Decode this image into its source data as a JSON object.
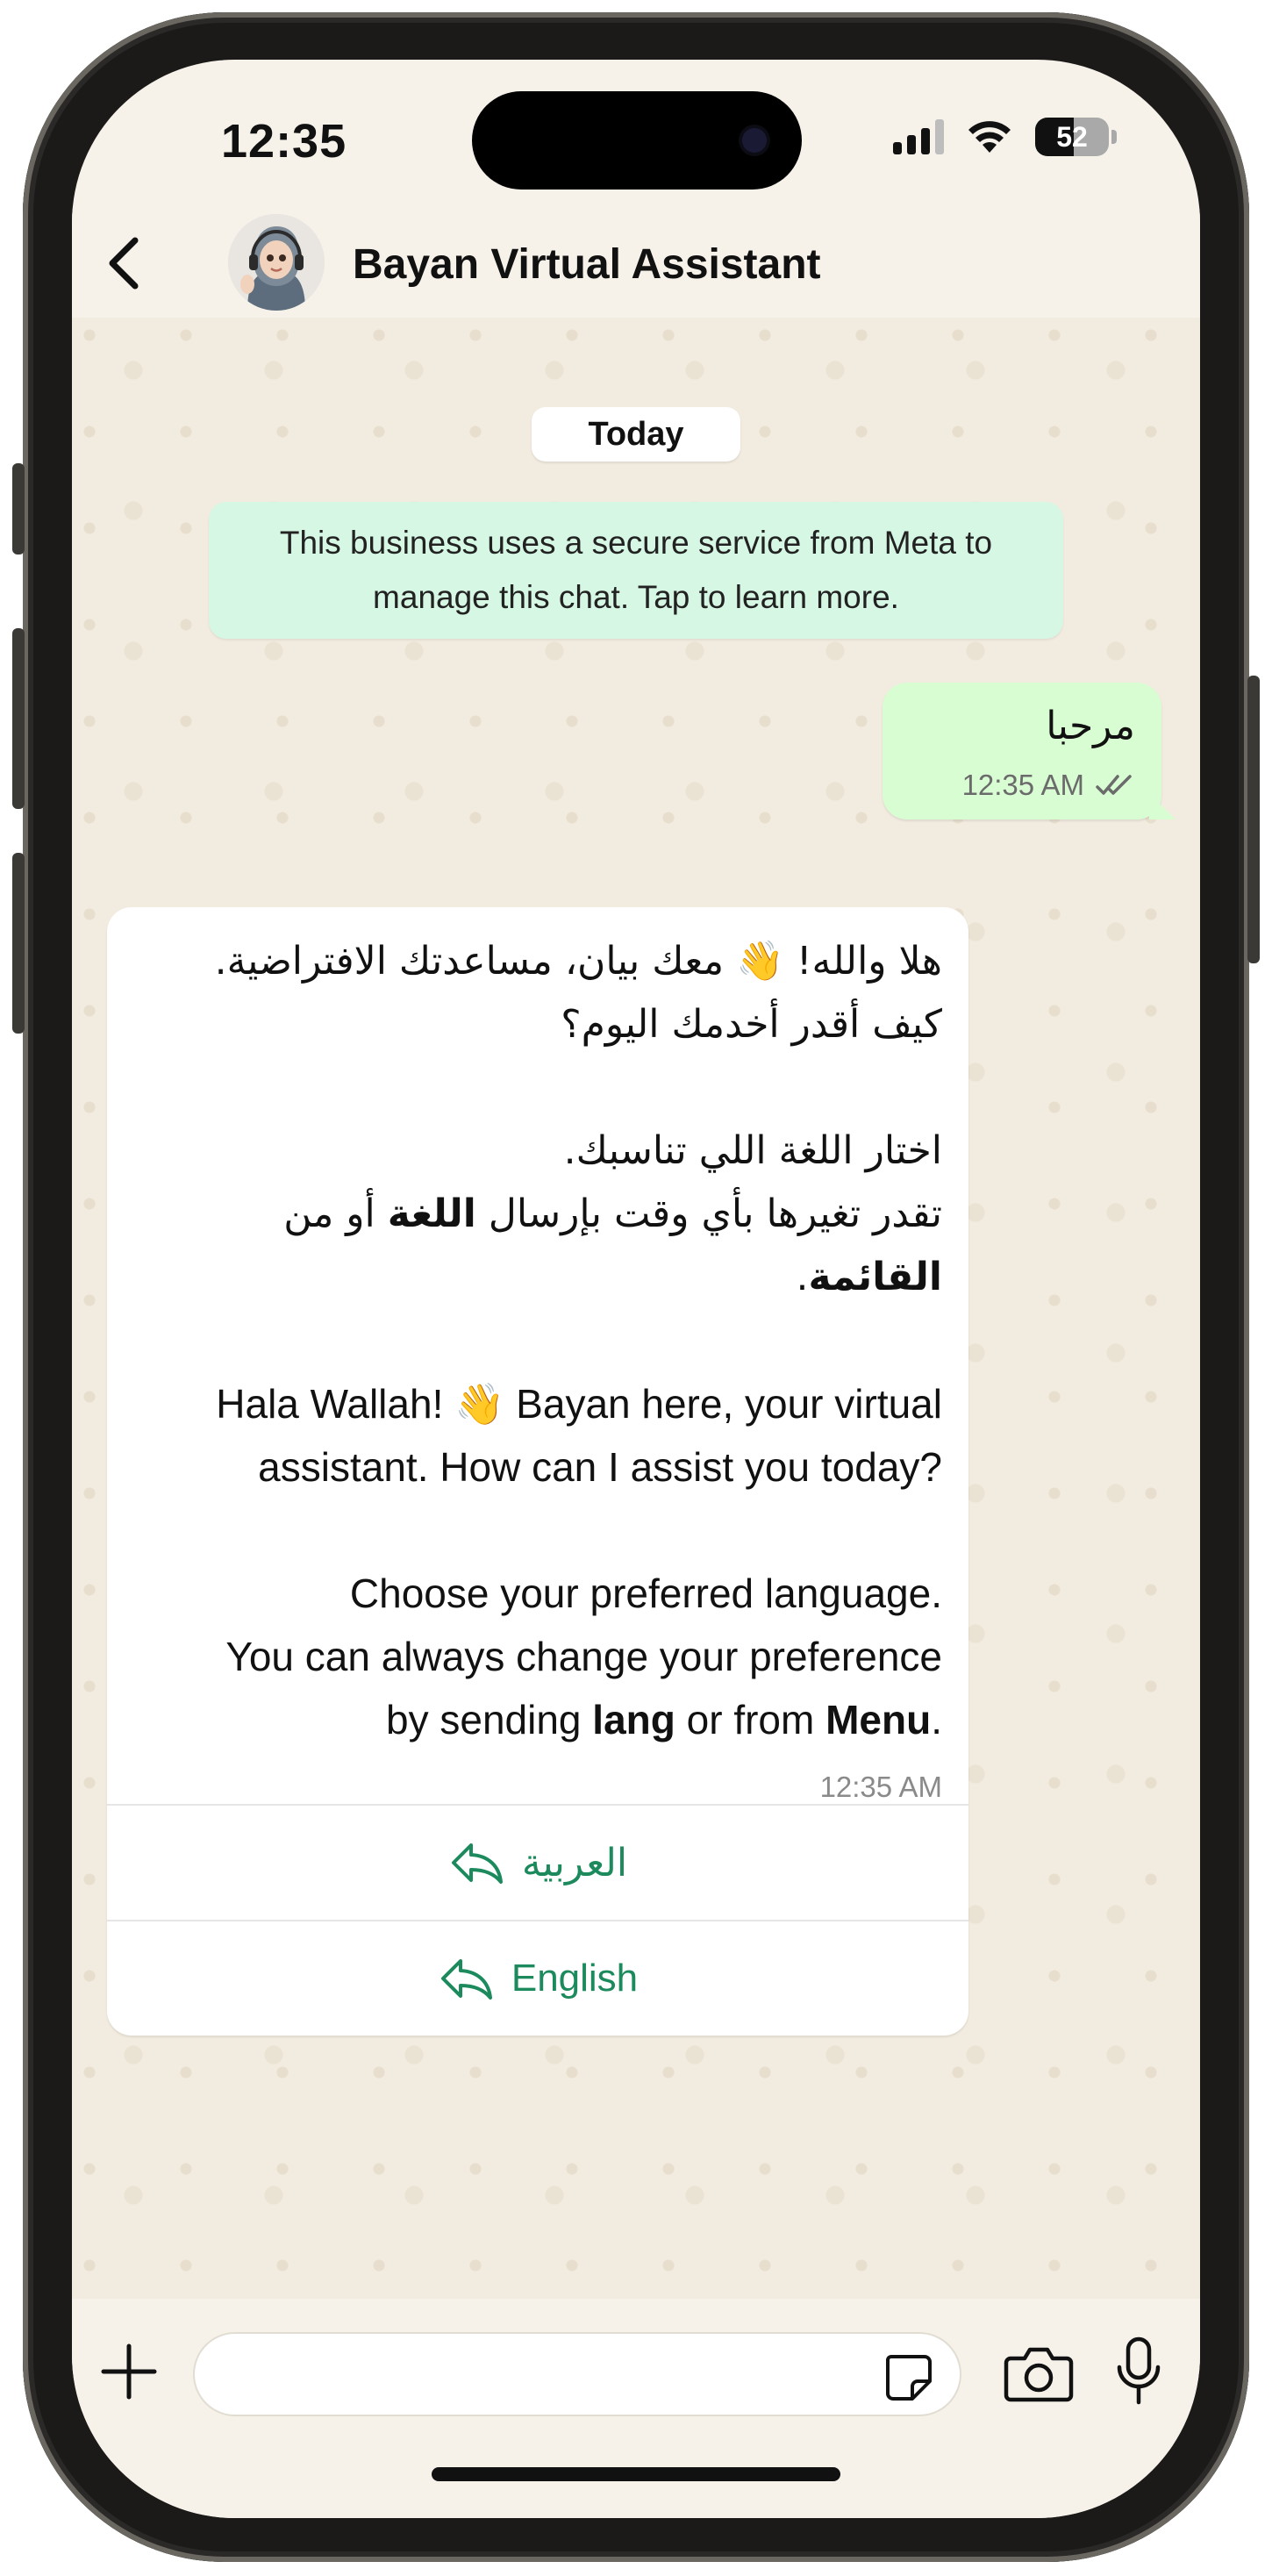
{
  "status_bar": {
    "time": "12:35",
    "battery": "52",
    "battery_level_percent": 52
  },
  "header": {
    "back_icon": "chevron-left-icon",
    "avatar_icon": "assistant-avatar",
    "title": "Bayan Virtual Assistant"
  },
  "chat": {
    "date_label": "Today",
    "notice_line1": "This business uses a secure service from Meta to",
    "notice_line2": "manage this chat. Tap to learn more.",
    "outgoing": {
      "text": "مرحبا",
      "time": "12:35 AM",
      "status_icon": "double-check-icon"
    },
    "incoming": {
      "ar_line1": "هلا والله! 👋 معك بيان، مساعدتك الافتراضية.",
      "ar_line2": "كيف أقدر أخدمك اليوم؟",
      "ar_line3": "اختار اللغة اللي تناسبك.",
      "ar_line4_pre": "تقدر تغيرها بأي وقت بإرسال ",
      "ar_line4_bold": "اللغة",
      "ar_line4_post": " أو من",
      "ar_line5_bold": "القائمة",
      "ar_line5_post": ".",
      "en_line1": "Hala Wallah! 👋 Bayan here, your virtual",
      "en_line2": "assistant. How can I assist you today?",
      "en_line3": "Choose your preferred language.",
      "en_line4": "You can always change your preference",
      "en_line5_pre": "by sending ",
      "en_line5_bold1": "lang",
      "en_line5_mid": " or from ",
      "en_line5_bold2": "Menu",
      "en_line5_post": ".",
      "time": "12:35 AM"
    },
    "quick_replies": [
      {
        "label": "العربية",
        "icon": "reply-arrow-icon"
      },
      {
        "label": "English",
        "icon": "reply-arrow-icon"
      }
    ]
  },
  "composer": {
    "attach_icon": "plus-icon",
    "input_value": "",
    "sticker_icon": "sticker-icon",
    "camera_icon": "camera-icon",
    "mic_icon": "microphone-icon"
  },
  "colors": {
    "outgoing_bubble": "#d9fdd3",
    "notice_bg": "#d6f7e4",
    "quick_reply_text": "#1c8a5c",
    "chat_bg": "#f2ebdf"
  }
}
